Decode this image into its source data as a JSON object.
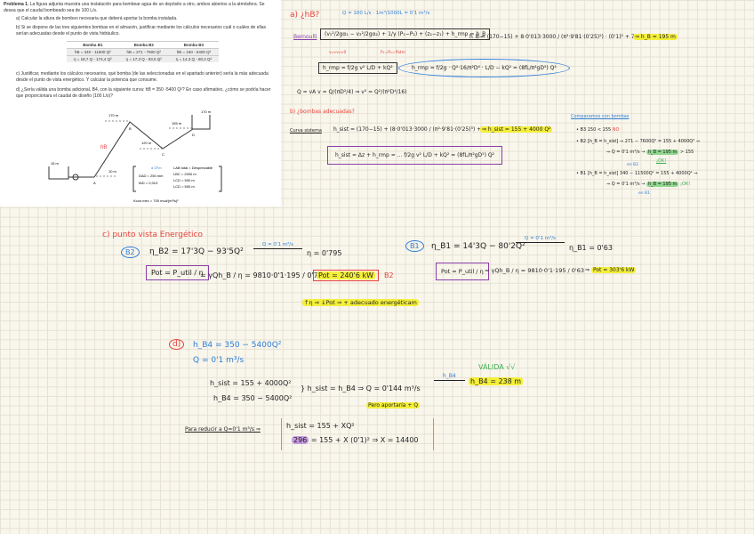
{
  "problem": {
    "title": "Problema 1.",
    "intro": "La figura adjunta muestra una instalación para bombear agua de un depósito a otro, ambos abiertos a la atmósfera. Se desea que el caudal bombeado sea de 100 L/s.",
    "a": "a) Calcular la altura de bombeo necesaria que deberá aportar la bomba instalada.",
    "b": "b) Si se dispone de las tres siguientes bombas en el almacén, justificar mediante los cálculos necesarios cuál o cuáles de ellas serían adecuadas desde el punto de vista hidráulico.",
    "pumps_table": {
      "headers": [
        "Bomba B1",
        "Bomba B2",
        "Bomba B3"
      ],
      "rows": [
        [
          "hB = 340 - 11500 Q²",
          "hB = 271 - 7600 Q²",
          "hB = 150 - 5400 Q²"
        ],
        [
          "η = 18,7 Q - 174,4 Q²",
          "η = 17,3 Q - 93,5 Q²",
          "η = 14,3 Q - 80,2 Q²"
        ]
      ]
    },
    "c": "c) Justificar, mediante los cálculos necesarios, qué bomba (de las seleccionadas en el apartado anterior) sería la más adecuada desde el punto de vista energético. Y calcular la potencia que consume.",
    "d": "d) ¿Sería válida una bomba adicional, B4, con la siguiente curva: hB = 350 -5400 Q²? En caso afirmativo, ¿cómo se podría hacer que proporcionara el caudal de diseño (100 L/s)?",
    "diagram": {
      "levels": [
        "170 m",
        "170 m",
        "155 m",
        "120 m",
        "15 m",
        "10 m"
      ],
      "points": [
        "A",
        "B",
        "C",
        "D"
      ],
      "hb_label": "hB",
      "params_left": [
        "d ΣFm",
        "DAD = 250 mm",
        "fAD = 0,013"
      ],
      "params_right": [
        "LAB total = Despreciable",
        "LBC = 2000 m",
        "LCD = 500 m",
        "LCD = 500 m"
      ],
      "k_label": "Kcon,mec = 700 mca/(m³/s)²"
    }
  },
  "notes": {
    "a_label": "a) ¿hB?",
    "q_conv": "Q = 100 L/s · 1m³/1000L = 0'1 m³/s",
    "bernoulli_label": "Bernoulli",
    "bernoulli_eq": "(v₁²/2gα₁ − v₂²/2gα₂) + 1/γ (P₁−P₂) + (z₂−z₁) + h_rmp = h_B",
    "bern_note1": "v₁≈v₂≈0",
    "bern_note2": "P₁=P₂=Patm",
    "hb_calc": "h_B = (170−15) + 8·0'013·3000 / (π²·9'81·(0'25)⁵) · (0'1)² + 700 (0'1)²",
    "hb_result": "⇒ h_B = 195 m",
    "hrmp_eq": "h_rmp = f/2g v² L/D + kQ²",
    "hrmp_expand": "h_rmp = f/2g · Q²·16/π²D⁴ · L/D − kQ² = (8fL/π²gD⁵) Q²",
    "q_va": "Q = vA   v = Q/(πD²/4) ⇒ v² = Q²/(π²D⁴/16)",
    "b_label": "b) ¿bombas adecuadas?",
    "curva_label": "Curva sistema",
    "hsist_calc": "h_sist = (170−15) + (8·0'013·3000 / (π²·9'81·(0'25)⁵) + 700) Q²",
    "hsist_result": "⇒ h_sist = 155 + 4000 Q²",
    "hsist_def": "h_sist = Δz + h_rmp = ... f/2g v² L/D + kQ² = (8fL/π²gD⁵) Q²",
    "compare_label": "Comparamos con bombas",
    "b3_line": "• B3   150 < 155",
    "b3_no": "NO",
    "b2_line": "• B2   [h_B = h_sist] ⇒ 271 − 7600Q² = 155 + 4000Q² ⇒",
    "b2_q": "⇒ Q = 0'1 m³/s",
    "b2_hb": "h_B = 195 m",
    "b2_cmp": "> 155",
    "b2_ok": "¡OK!",
    "en_b2": "en B2",
    "b1_line": "• B1   [h_B = h_sist]  340 − 11500Q² = 155 + 4000Q² ⇒",
    "b1_q": "⇒ Q = 0'1 m³/s",
    "b1_hb": "h_B = 195 m",
    "b1_ok": "¡OK!",
    "en_b1": "en B1",
    "c_label": "c) punto vista Energético",
    "b2_tag": "B2",
    "b2_eta": "η_B2 = 17'3Q − 93'5Q²",
    "q_arrow": "Q = 0'1 m³/s",
    "b2_eta_res": "η = 0'795",
    "pot_def": "Pot = P_util / η",
    "pot_b2": "= γQh_B / η = 9810·0'1·195 / 0'795",
    "pot_b2_res": "Pot = 240'6 kW",
    "b2_mark": "B2",
    "b1_tag": "B1",
    "b1_eta": "η_B1 = 14'3Q − 80'2Q²",
    "b1_eta_res": "η_B1 = 0'63",
    "pot_b1": "= γQh_B / η = 9810·0'1·195 / 0'63",
    "pot_b1_res": "Pot = 303'6 kW",
    "conclusion": "↑η ⇒ ↓Pot ⇒ + adecuado energéticam",
    "d_label": "d)",
    "hb4": "h_B4 = 350 − 5400Q²",
    "q_d": "Q = 0'1 m³/s",
    "sys1": "h_sist = 155 + 4000Q²",
    "sys2": "h_B4 = 350 − 5400Q²",
    "sys_eq": "} h_sist = h_B4 ⇒ Q = 0'144 m³/s",
    "hb4_arrow": "h_B4",
    "hb4_res": "h_B4 = 238 m",
    "valida": "VÁLIDA √√",
    "aporta": "Pero aportaría + Q",
    "reducir": "Para reducir a Q=0'1 m³/s ⇒",
    "red1": "h_sist = 155 + XQ²",
    "red2_val": "296",
    "red2": "= 155 + X (0'1)² ⇒ X = 14400"
  },
  "colors": {
    "red": "#e8433d",
    "blue": "#2f7fd8",
    "green": "#3cae4e",
    "purple": "#8a3fa8",
    "yellow": "#f4ef3a"
  }
}
